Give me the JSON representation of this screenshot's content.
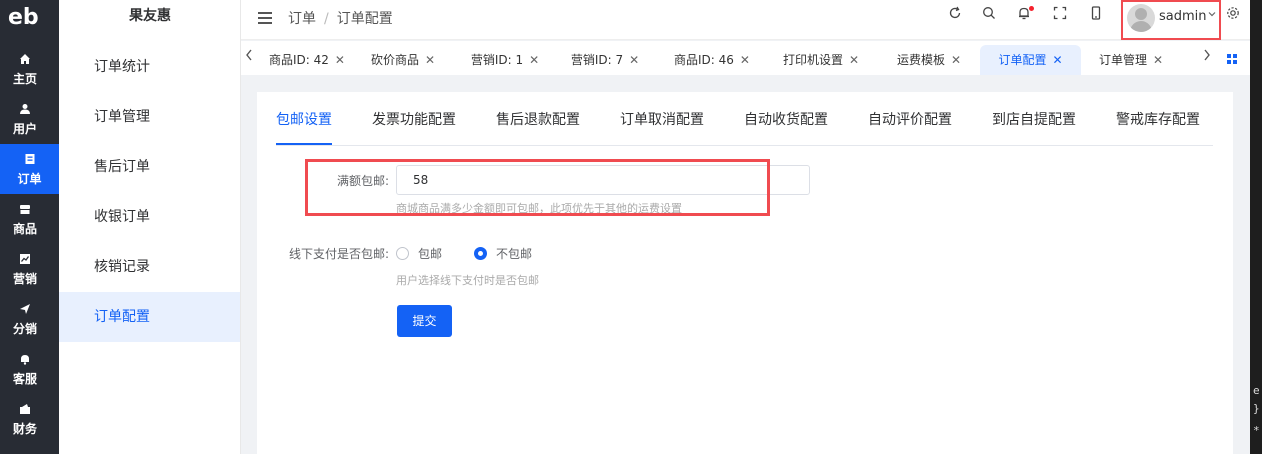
{
  "logo": "eb",
  "rail": [
    {
      "icon": "home-icon",
      "label": "主页"
    },
    {
      "icon": "user-icon",
      "label": "用户"
    },
    {
      "icon": "order-icon",
      "label": "订单"
    },
    {
      "icon": "goods-icon",
      "label": "商品"
    },
    {
      "icon": "marketing-icon",
      "label": "营销"
    },
    {
      "icon": "distribution-icon",
      "label": "分销"
    },
    {
      "icon": "service-icon",
      "label": "客服"
    },
    {
      "icon": "finance-icon",
      "label": "财务"
    }
  ],
  "app_name": "果友惠",
  "submenu": [
    "订单统计",
    "订单管理",
    "售后订单",
    "收银订单",
    "核销记录",
    "订单配置"
  ],
  "breadcrumb": [
    "订单",
    "订单配置"
  ],
  "header_icons": [
    "refresh-icon",
    "search-icon",
    "bell-icon",
    "fullscreen-icon",
    "mobile-icon",
    "settings-icon"
  ],
  "user": {
    "name": "sadmin"
  },
  "tabs": [
    {
      "label": "商品ID: 42"
    },
    {
      "label": "砍价商品"
    },
    {
      "label": "营销ID: 1"
    },
    {
      "label": "营销ID: 7"
    },
    {
      "label": "商品ID: 46"
    },
    {
      "label": "打印机设置"
    },
    {
      "label": "运费模板"
    },
    {
      "label": "订单配置"
    },
    {
      "label": "订单管理"
    }
  ],
  "config_tabs": [
    "包邮设置",
    "发票功能配置",
    "售后退款配置",
    "订单取消配置",
    "自动收货配置",
    "自动评价配置",
    "到店自提配置",
    "警戒库存配置"
  ],
  "form": {
    "free_shipping_label": "满额包邮:",
    "free_shipping_value": "58",
    "free_shipping_help": "商城商品满多少金额即可包邮，此项优先于其他的运费设置",
    "offline_label": "线下支付是否包邮:",
    "offline_options": [
      "包邮",
      "不包邮"
    ],
    "offline_selected": "不包邮",
    "offline_help": "用户选择线下支付时是否包邮",
    "submit": "提交"
  },
  "colors": {
    "primary": "#1462f5",
    "rail_bg": "#282c34",
    "highlight_border": "#f04b50"
  }
}
